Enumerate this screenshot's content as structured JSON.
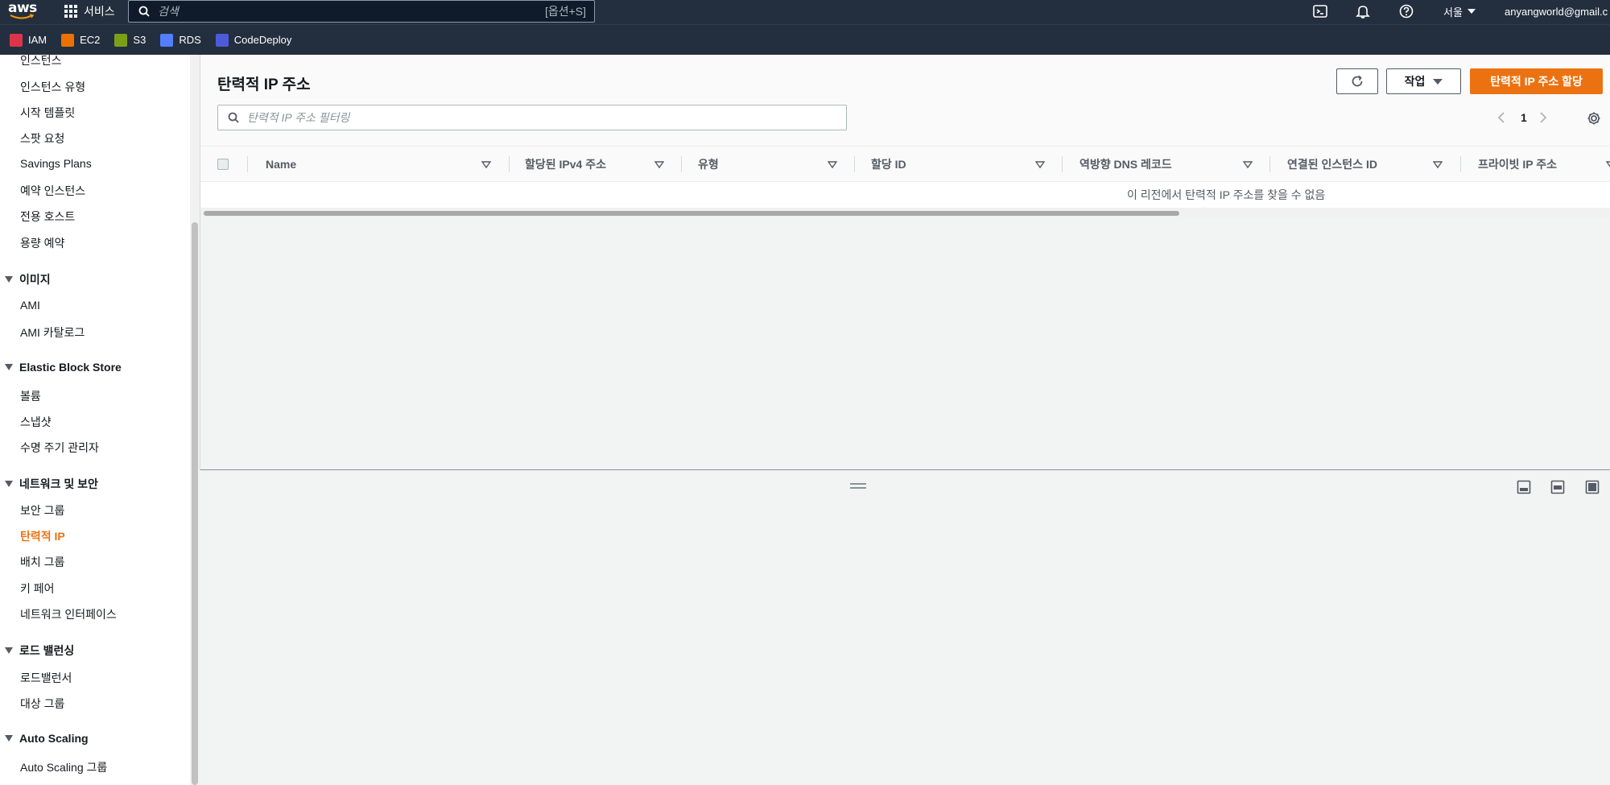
{
  "topnav": {
    "logo_text": "aws",
    "services_label": "서비스",
    "search_placeholder": "검색",
    "search_shortcut": "[옵션+S]",
    "region": "서울",
    "account": "anyangworld@gmail.c"
  },
  "favorites": [
    {
      "label": "IAM",
      "color": "#dd344c"
    },
    {
      "label": "EC2",
      "color": "#ed7100"
    },
    {
      "label": "S3",
      "color": "#7aa116"
    },
    {
      "label": "RDS",
      "color": "#527fff"
    },
    {
      "label": "CodeDeploy",
      "color": "#4d5bdb"
    }
  ],
  "sidebar": {
    "items_top": [
      "인스턴스",
      "인스턴스 유형",
      "시작 템플릿",
      "스팟 요청",
      "Savings Plans",
      "예약 인스턴스",
      "전용 호스트",
      "용량 예약"
    ],
    "sections": [
      {
        "title": "이미지",
        "items": [
          "AMI",
          "AMI 카탈로그"
        ]
      },
      {
        "title": "Elastic Block Store",
        "items": [
          "볼륨",
          "스냅샷",
          "수명 주기 관리자"
        ]
      },
      {
        "title": "네트워크 및 보안",
        "items": [
          "보안 그룹",
          "탄력적 IP",
          "배치 그룹",
          "키 페어",
          "네트워크 인터페이스"
        ]
      },
      {
        "title": "로드 밸런싱",
        "items": [
          "로드밸런서",
          "대상 그룹"
        ]
      },
      {
        "title": "Auto Scaling",
        "items": [
          "Auto Scaling 그룹"
        ]
      }
    ],
    "active_item": "탄력적 IP"
  },
  "main": {
    "title": "탄력적 IP 주소",
    "actions_label": "작업",
    "allocate_label": "탄력적 IP 주소 할당",
    "filter_placeholder": "탄력적 IP 주소 필터링",
    "page_number": "1",
    "columns": [
      "Name",
      "할당된 IPv4 주소",
      "유형",
      "할당 ID",
      "역방향 DNS 레코드",
      "연결된 인스턴스 ID",
      "프라이빗 IP 주소"
    ],
    "empty_message": "이 리전에서 탄력적 IP 주소를 찾을 수 없음"
  },
  "colors": {
    "nav_bg": "#232f3e",
    "accent": "#ec7211",
    "primary_button": "#ec7211"
  }
}
